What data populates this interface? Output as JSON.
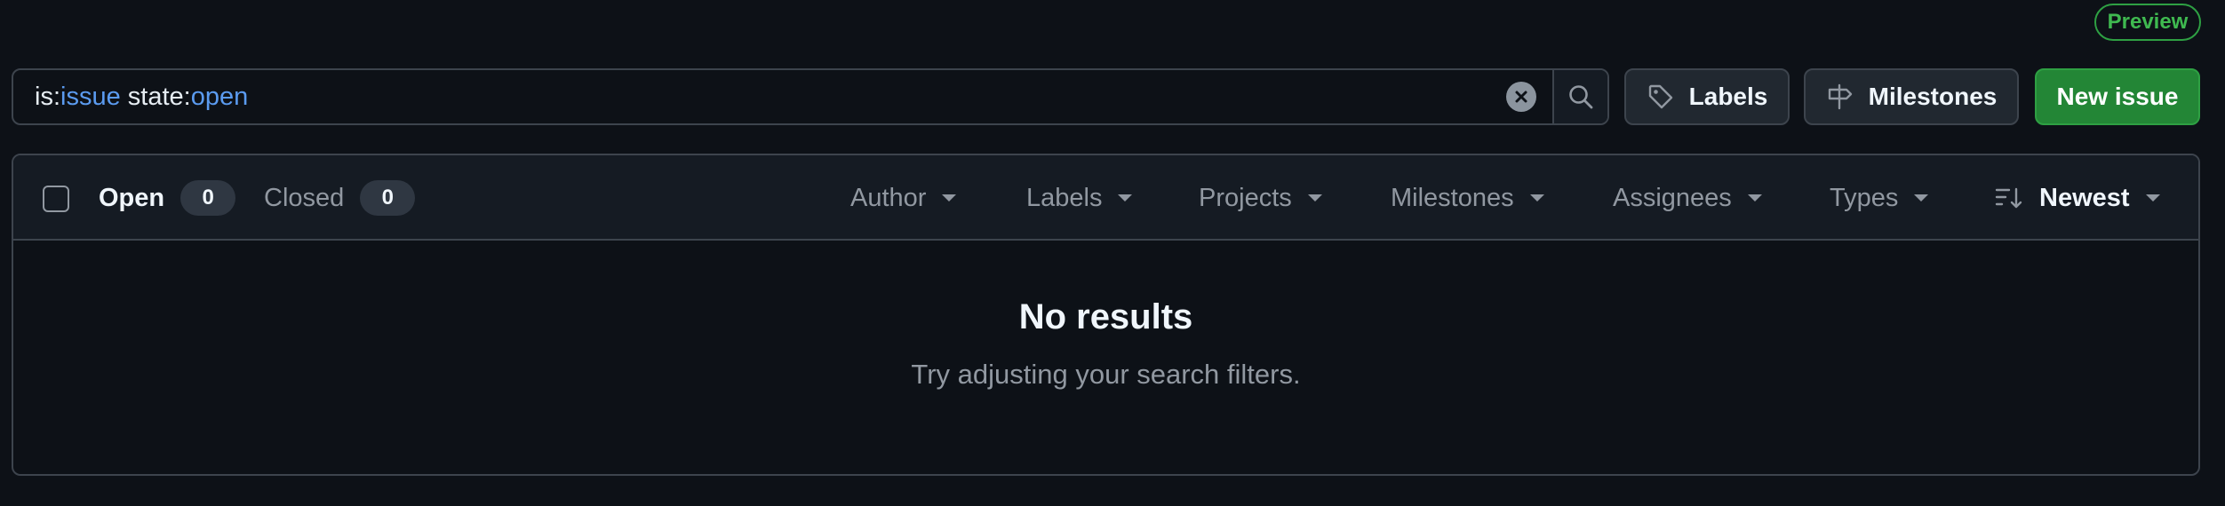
{
  "preview_badge": "Preview",
  "search": {
    "tokens": [
      {
        "key": "is:",
        "value": "issue"
      },
      {
        "key": "state:",
        "value": "open"
      }
    ]
  },
  "toolbar": {
    "labels_label": "Labels",
    "milestones_label": "Milestones",
    "new_issue_label": "New issue"
  },
  "list_header": {
    "open_label": "Open",
    "open_count": "0",
    "closed_label": "Closed",
    "closed_count": "0",
    "filters": {
      "author": "Author",
      "labels": "Labels",
      "projects": "Projects",
      "milestones": "Milestones",
      "assignees": "Assignees",
      "types": "Types"
    },
    "sort_label": "Newest"
  },
  "empty_state": {
    "title": "No results",
    "subtitle": "Try adjusting your search filters."
  },
  "colors": {
    "background": "#0d1117",
    "accent_blue": "#5b9bf0",
    "primary_green": "#238636",
    "border": "#3d444d"
  },
  "icons": [
    "clear-icon",
    "search-icon",
    "tag-icon",
    "milestone-icon",
    "sort-icon",
    "caret-down-icon"
  ]
}
